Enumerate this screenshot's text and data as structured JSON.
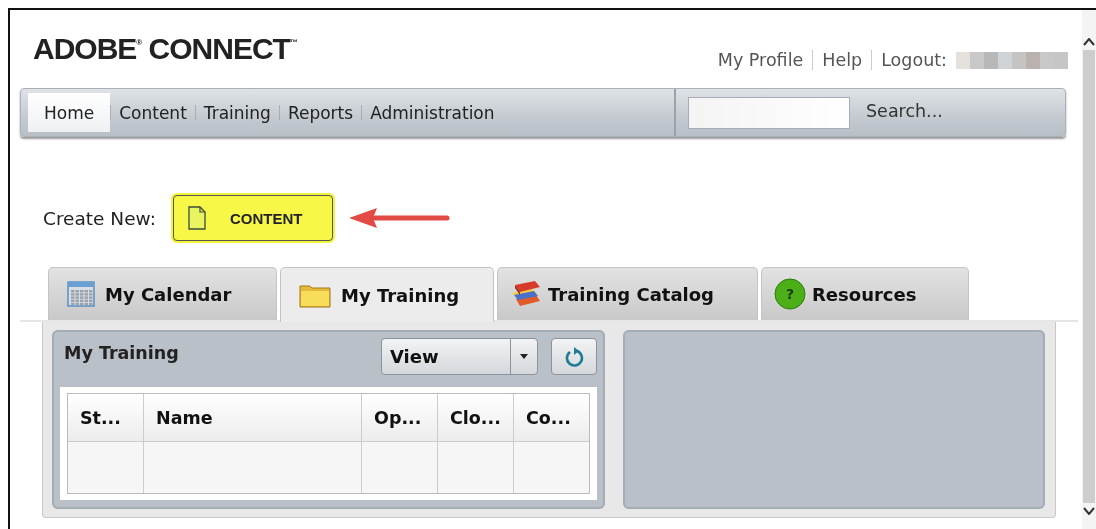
{
  "logo": "ADOBE$^{®}$ CONNECT$^{™}$",
  "top_links": [
    {
      "label": "My Profile"
    },
    {
      "label": "Help"
    },
    {
      "label": "Logout:"
    }
  ],
  "nav": {
    "items": [
      {
        "label": "Home",
        "selected": true
      },
      {
        "label": "Content",
        "selected": false
      },
      {
        "label": "Training",
        "selected": false
      },
      {
        "label": "Reports",
        "selected": false
      },
      {
        "label": "Administration",
        "selected": false
      }
    ],
    "search_button": "Search..."
  },
  "create_new": {
    "label": "Create New:",
    "button": "CONTENT"
  },
  "tabs": [
    {
      "label": "My Calendar",
      "kind": "calendar",
      "selected": false
    },
    {
      "label": "My Training",
      "kind": "folder",
      "selected": true
    },
    {
      "label": "Training Catalog",
      "kind": "books",
      "selected": false
    },
    {
      "label": "Resources",
      "kind": "help",
      "icon_text": "?",
      "selected": false
    }
  ],
  "panel": {
    "title": "My Training",
    "view": "View",
    "columns": [
      "St...",
      "Name",
      "Op...",
      "Clo...",
      "Co..."
    ]
  }
}
